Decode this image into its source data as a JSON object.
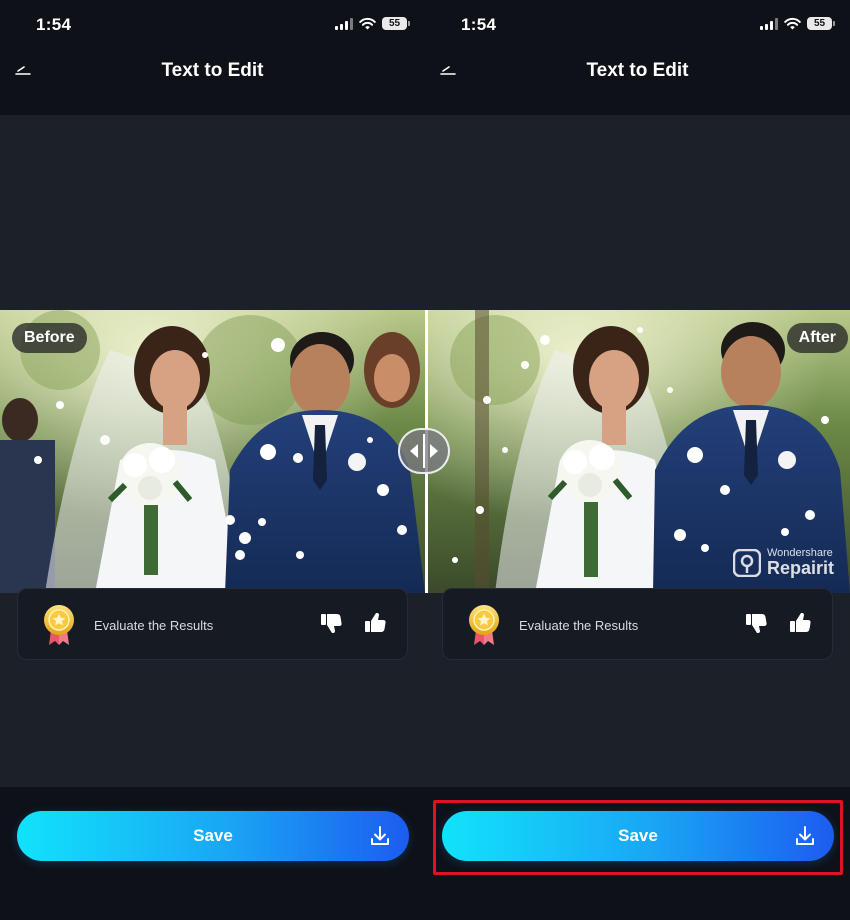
{
  "screens": [
    {
      "status": {
        "time": "1:54",
        "battery": "55"
      },
      "header": {
        "title": "Text to Edit"
      },
      "image_label": "Before",
      "evaluate": {
        "label": "Evaluate the Results"
      },
      "save": {
        "label": "Save"
      }
    },
    {
      "status": {
        "time": "1:54",
        "battery": "55"
      },
      "header": {
        "title": "Text to Edit"
      },
      "image_label": "After",
      "watermark": {
        "brand_small": "Wondershare",
        "brand_big": "Repairit"
      },
      "evaluate": {
        "label": "Evaluate the Results"
      },
      "save": {
        "label": "Save"
      }
    }
  ],
  "icons": {
    "back": "back-icon",
    "signal": "signal-icon",
    "wifi": "wifi-icon",
    "battery": "battery-icon",
    "medal": "medal-icon",
    "thumb_down": "thumbs-down-icon",
    "thumb_up": "thumbs-up-icon",
    "download": "download-icon",
    "compare_handle": "compare-handle-icon"
  },
  "colors": {
    "background": "#0e1117",
    "canvas": "#1c2028",
    "save_gradient_start": "#11e3fb",
    "save_gradient_end": "#1c5cf0",
    "highlight_border": "#e0121f"
  }
}
